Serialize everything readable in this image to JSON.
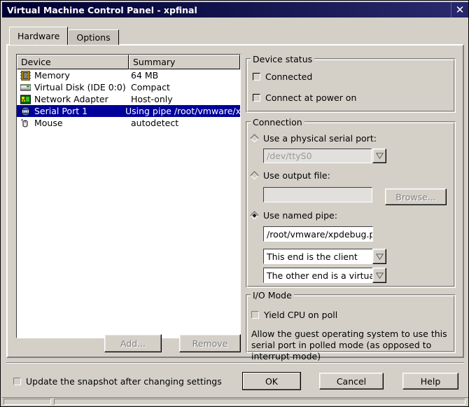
{
  "window": {
    "title": "Virtual Machine Control Panel - xpfinal",
    "close_label": "✕",
    "titlebar_color": "#161650",
    "face_color": "#d4d0c8",
    "selection_color": "#00019a"
  },
  "tabs": [
    {
      "label": "Hardware",
      "active": true
    },
    {
      "label": "Options",
      "active": false
    }
  ],
  "device_list": {
    "columns": [
      "Device",
      "Summary"
    ],
    "rows": [
      {
        "icon": "memory-icon",
        "device": "Memory",
        "summary": "64 MB",
        "selected": false
      },
      {
        "icon": "harddisk-icon",
        "device": "Virtual Disk (IDE 0:0)",
        "summary": "Compact",
        "selected": false
      },
      {
        "icon": "network-adapter-icon",
        "device": "Network Adapter",
        "summary": "Host-only",
        "selected": false
      },
      {
        "icon": "serial-port-icon",
        "device": "Serial Port 1",
        "summary": "Using pipe /root/vmware/xp",
        "selected": true
      },
      {
        "icon": "mouse-icon",
        "device": "Mouse",
        "summary": "autodetect",
        "selected": false
      }
    ],
    "add_label": "Add...",
    "remove_label": "Remove"
  },
  "device_status": {
    "title": "Device status",
    "connected": {
      "label": "Connected",
      "checked": false
    },
    "connect_at_power_on": {
      "label": "Connect at power on",
      "checked": false
    }
  },
  "connection": {
    "title": "Connection",
    "physical": {
      "label": "Use a physical serial port:",
      "selected": false,
      "value": "/dev/ttyS0",
      "disabled": true
    },
    "output_file": {
      "label": "Use output file:",
      "selected": false,
      "value": "",
      "browse_label": "Browse...",
      "disabled": true
    },
    "named_pipe": {
      "label": "Use named pipe:",
      "selected": true,
      "pipe_path": "/root/vmware/xpdebug.pipe",
      "near_end": "This end is the client",
      "far_end": "The other end is a virtual m"
    }
  },
  "io_mode": {
    "title": "I/O Mode",
    "yield_cpu": {
      "label": "Yield CPU on poll",
      "checked": false
    },
    "description": "Allow the guest operating system to use this serial port in polled mode (as opposed to interrupt mode)"
  },
  "footer": {
    "update_snapshot": {
      "label": "Update the snapshot after changing settings",
      "checked": false
    },
    "ok_label": "OK",
    "cancel_label": "Cancel",
    "help_label": "Help"
  }
}
